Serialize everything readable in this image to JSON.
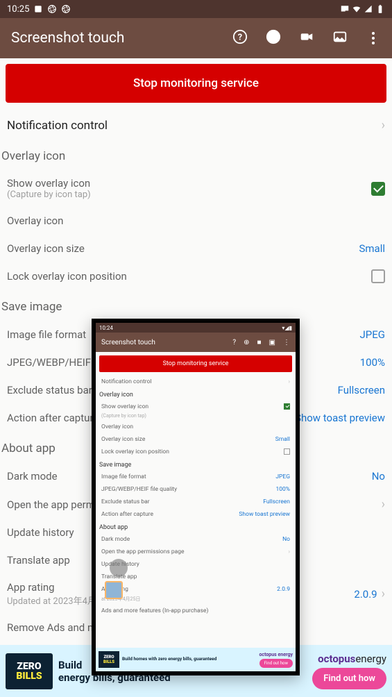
{
  "status": {
    "time": "10:25"
  },
  "appbar": {
    "title": "Screenshot touch"
  },
  "stop_button": "Stop monitoring service",
  "sections": {
    "notification": "Notification control",
    "overlay": "Overlay icon",
    "save": "Save image",
    "about": "About app"
  },
  "overlay": {
    "show": {
      "label": "Show overlay icon",
      "sub": "(Capture by icon tap)",
      "checked": true
    },
    "icon": {
      "label": "Overlay icon"
    },
    "size": {
      "label": "Overlay icon size",
      "value": "Small"
    },
    "lock": {
      "label": "Lock overlay icon position",
      "checked": false
    }
  },
  "save": {
    "format": {
      "label": "Image file format",
      "value": "JPEG"
    },
    "quality": {
      "label": "JPEG/WEBP/HEIF file quality",
      "value": "100%"
    },
    "exclude": {
      "label": "Exclude status bar",
      "value": "Fullscreen"
    },
    "after": {
      "label": "Action after capture",
      "value": "Show toast preview"
    }
  },
  "about": {
    "dark": {
      "label": "Dark mode",
      "value": "No"
    },
    "perms": {
      "label": "Open the app permi"
    },
    "history": {
      "label": "Update history"
    },
    "translate": {
      "label": "Translate app"
    },
    "rating": {
      "label": "App rating",
      "value": "2.0.9",
      "sub": "Updated at 2023年4月"
    },
    "remove": {
      "label": "Remove Ads and m"
    }
  },
  "ad": {
    "logo1": "ZERO",
    "logo2": "BILLS",
    "text": "Build",
    "text2": "energy bills, guaranteed",
    "brand1": "octopus",
    "brand2": "energy",
    "cta": "Find out how"
  },
  "preview": {
    "time": "10:24",
    "title": "Screenshot touch",
    "stop": "Stop monitoring service",
    "notification": "Notification control",
    "overlay_h": "Overlay icon",
    "show": "Show overlay icon",
    "show_sub": "(Capture by icon tap)",
    "ovicon": "Overlay icon",
    "size": "Overlay icon size",
    "size_v": "Small",
    "lock": "Lock overlay icon position",
    "save_h": "Save image",
    "format": "Image file format",
    "format_v": "JPEG",
    "quality": "JPEG/WEBP/HEIF file quality",
    "quality_v": "100%",
    "exclude": "Exclude status bar",
    "exclude_v": "Fullscreen",
    "after": "Action after capture",
    "after_v": "Show toast preview",
    "about_h": "About app",
    "dark": "Dark mode",
    "dark_v": "No",
    "perms": "Open the app permissions page",
    "history": "Update history",
    "translate": "Translate app",
    "rating": "App rating",
    "rating_v": "2.0.9",
    "rating_sub": "at 2023年4月25日",
    "remove": "Ads and more features (In-app purchase)",
    "ad_text": "Build homes with zero energy bills, guaranteed",
    "ad_brand": "octopus energy",
    "ad_cta": "Find out how"
  }
}
